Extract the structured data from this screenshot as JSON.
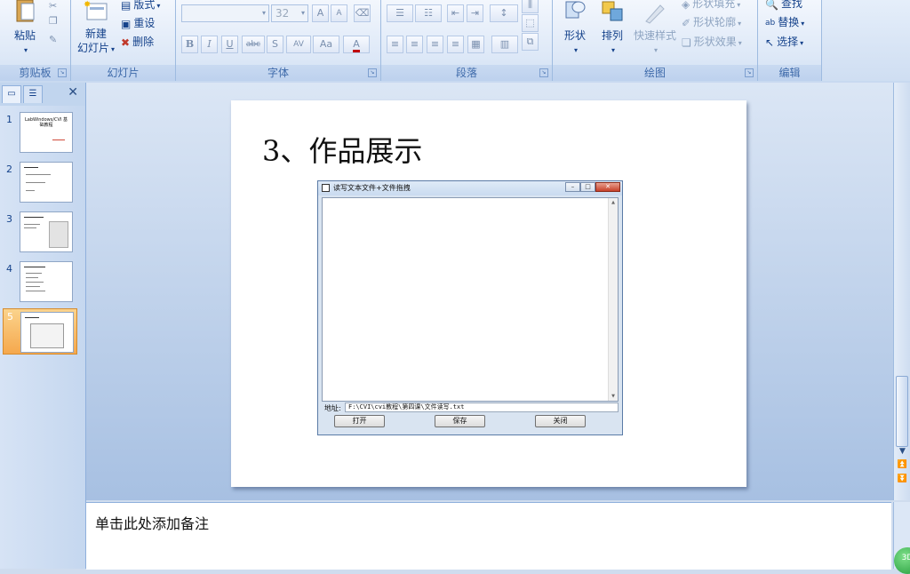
{
  "ribbon": {
    "clipboard": {
      "label": "剪贴板",
      "paste": "粘贴"
    },
    "slides": {
      "label": "幻灯片",
      "new_slide_1": "新建",
      "new_slide_2": "幻灯片",
      "layout": "版式",
      "reset": "重设",
      "delete": "删除"
    },
    "font": {
      "label": "字体",
      "font_name": "",
      "font_size": "32",
      "bold": "B",
      "italic": "I",
      "underline": "U",
      "strike": "abc",
      "shadow": "S",
      "spacing": "AV",
      "case": "Aa",
      "color": "A",
      "grow": "A",
      "shrink": "A"
    },
    "paragraph": {
      "label": "段落"
    },
    "drawing": {
      "label": "绘图",
      "shapes": "形状",
      "arrange": "排列",
      "quick_styles": "快速样式",
      "shape_fill": "形状填充",
      "shape_outline": "形状轮廓",
      "shape_effects": "形状效果"
    },
    "editing": {
      "label": "编辑",
      "find": "查找",
      "replace": "替换",
      "select": "选择"
    }
  },
  "left_panel": {
    "close": "✕",
    "slides": [
      {
        "num": "1",
        "title": "LabWindows/CVI 基础教程"
      },
      {
        "num": "2",
        "title": ""
      },
      {
        "num": "3",
        "title": ""
      },
      {
        "num": "4",
        "title": ""
      },
      {
        "num": "5",
        "title": ""
      }
    ],
    "selected": "5"
  },
  "slide": {
    "title": "3、作品展示",
    "window": {
      "title": "读写文本文件+文件拖拽",
      "address_label": "地址:",
      "address_value": "F:\\CVI\\cvi教程\\第四课\\文件读写.txt",
      "open_button": "打开",
      "save_button": "保存",
      "close_button": "关闭"
    }
  },
  "notes": {
    "placeholder": "单击此处添加备注"
  },
  "colors": {
    "ribbon_bg": "#dbe7f7",
    "selected_thumb": "#f5a84d",
    "slide_area": "#a7c0e2"
  }
}
